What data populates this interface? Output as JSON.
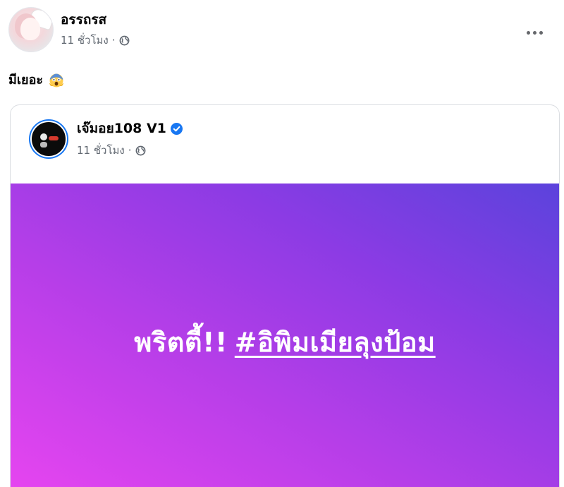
{
  "post": {
    "author": "อรรถรส",
    "time": "11 ชั่วโมง",
    "separator": "·",
    "privacy_icon": "globe-icon",
    "more_icon": "more-options-icon",
    "caption": "มีเยอะ",
    "caption_emoji": "shocked-face-emoji"
  },
  "shared_post": {
    "author": "เจ๊มอย108 V1",
    "verified_icon": "verified-badge-icon",
    "time": "11 ชั่วโมง",
    "separator": "·",
    "privacy_icon": "globe-icon",
    "text": "พริตตี้!!",
    "hashtag": "#อิพิมเมียลุงป้อม",
    "background_colors": [
      "#e845f0",
      "#b53ee8",
      "#8b3be4",
      "#5b43dc"
    ]
  },
  "colors": {
    "verified_blue": "#1877f2",
    "meta_gray": "#606770"
  }
}
